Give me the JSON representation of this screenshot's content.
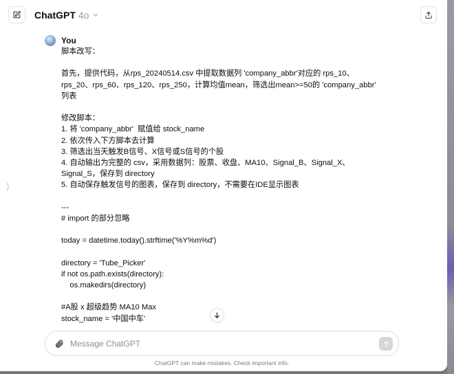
{
  "header": {
    "model_name": "ChatGPT",
    "model_version": "4o"
  },
  "icons": {
    "new_chat": "edit-icon",
    "share": "share-icon",
    "model_chevron": "chevron-down-icon",
    "attach": "paperclip-icon",
    "send": "arrow-up-icon",
    "scroll_down": "arrow-down-icon",
    "sidebar_handle": "chevron-right-icon"
  },
  "sidebar_handle": "⟩",
  "message": {
    "sender": "You",
    "lines": [
      "脚本改写：",
      "",
      "首先，提供代码，从rps_20240514.csv 中提取数据列 'company_abbr'对应的 rps_10、",
      "rps_20、rps_60、rps_120、rps_250，计算均值mean，筛选出mean>=50的 'company_abbr'",
      "列表",
      "",
      "修改脚本：",
      "1. 将 'company_abbr'  赋值给 stock_name",
      "2. 依次传入下方脚本去计算",
      "3. 筛选出当天触发B信号、X信号或S信号的个股",
      "4. 自动输出为完整的 csv，采用数据列：股票、收盘、MA10、Signal_B、Signal_X、",
      "Signal_S，保存到 directory",
      "5. 自动保存触发信号的图表，保存到 directory，不需要在IDE显示图表",
      "",
      "---",
      "# import 的部分忽略",
      "",
      "today = datetime.today().strftime('%Y%m%d')",
      "",
      "directory = 'Tube_Picker'",
      "if not os.path.exists(directory):",
      "    os.makedirs(directory)",
      "",
      "#A股 x 超级趋势 MA10 Max",
      "stock_name = '中国中车'"
    ]
  },
  "composer": {
    "placeholder": "Message ChatGPT",
    "value": ""
  },
  "disclaimer": "ChatGPT can make mistakes. Check important info.",
  "colors": {
    "background": "#ffffff",
    "text": "#0d0d0d",
    "muted": "#9b9b9b",
    "send_disabled": "#d7d7d7"
  }
}
